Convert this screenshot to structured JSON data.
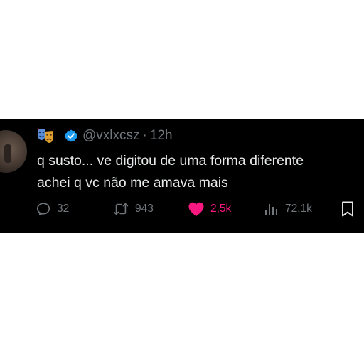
{
  "tweet": {
    "author": {
      "handle": "@vxlxcsz",
      "verified": true,
      "avatar_icon": "user-avatar",
      "emoji_icon": "performing-arts-masks-icon"
    },
    "separator": "·",
    "time": "12h",
    "text_lines": [
      "q susto... ve digitou de uma forma diferente",
      "achei q vc não me amava mais"
    ],
    "actions": {
      "replies": "32",
      "retweets": "943",
      "likes": "2,5k",
      "views": "72,1k",
      "liked": true
    },
    "colors": {
      "background": "#000000",
      "text": "#e7e9ea",
      "muted": "#71767b",
      "like": "#f91880",
      "verified": "#1d9bf0"
    }
  }
}
